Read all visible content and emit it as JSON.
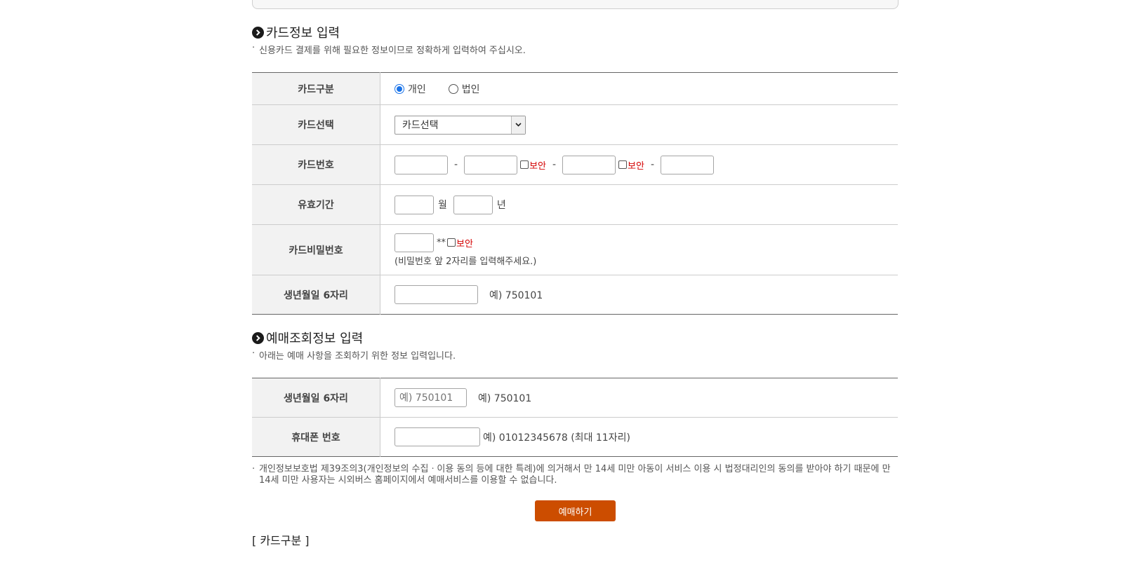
{
  "card_section": {
    "title": "카드정보 입력",
    "note": "신용카드 결제를 위해 필요한 정보이므로 정확하게 입력하여 주십시오.",
    "card_type_label": "카드구분",
    "card_type_options": [
      "개인",
      "법인"
    ],
    "card_type_selected": "개인",
    "card_select_label": "카드선택",
    "card_select_value": "카드선택",
    "card_number_label": "카드번호",
    "card_number_dash": "-",
    "secure_label": "보안",
    "expiry_label": "유효기간",
    "expiry_month_unit": "월",
    "expiry_year_unit": "년",
    "password_label": "카드비밀번호",
    "password_mask": "**",
    "password_hint": "(비밀번호 앞 2자리를 입력해주세요.)",
    "birth_label": "생년월일 6자리",
    "birth_example": "예) 750101"
  },
  "lookup_section": {
    "title": "예매조회정보 입력",
    "note": "아래는 예매 사항을 조회하기 위한 정보 입력입니다.",
    "birth_label": "생년월일 6자리",
    "birth_placeholder": "예) 750101",
    "birth_example": "예) 750101",
    "phone_label": "휴대폰 번호",
    "phone_example": "예) 01012345678 (최대 11자리)"
  },
  "legal_note": "개인정보보호법 제39조의3(개인정보의 수집ㆍ이용 동의 등에 대한 특례)에 의거해서 만 14세 미만 아동이 서비스 이용 시 법정대리인의 동의를 받아야 하기 때문에 만 14세 미만 사용자는 시외버스 홈페이지에서 예매서비스를 이용할 수 없습니다.",
  "bullet": "·",
  "submit_label": "예매하기",
  "bottom_heading": "[ 카드구분 ]",
  "colors": {
    "accent": "#cc4d00",
    "secure": "#d40000",
    "radio": "#1a73e8"
  }
}
